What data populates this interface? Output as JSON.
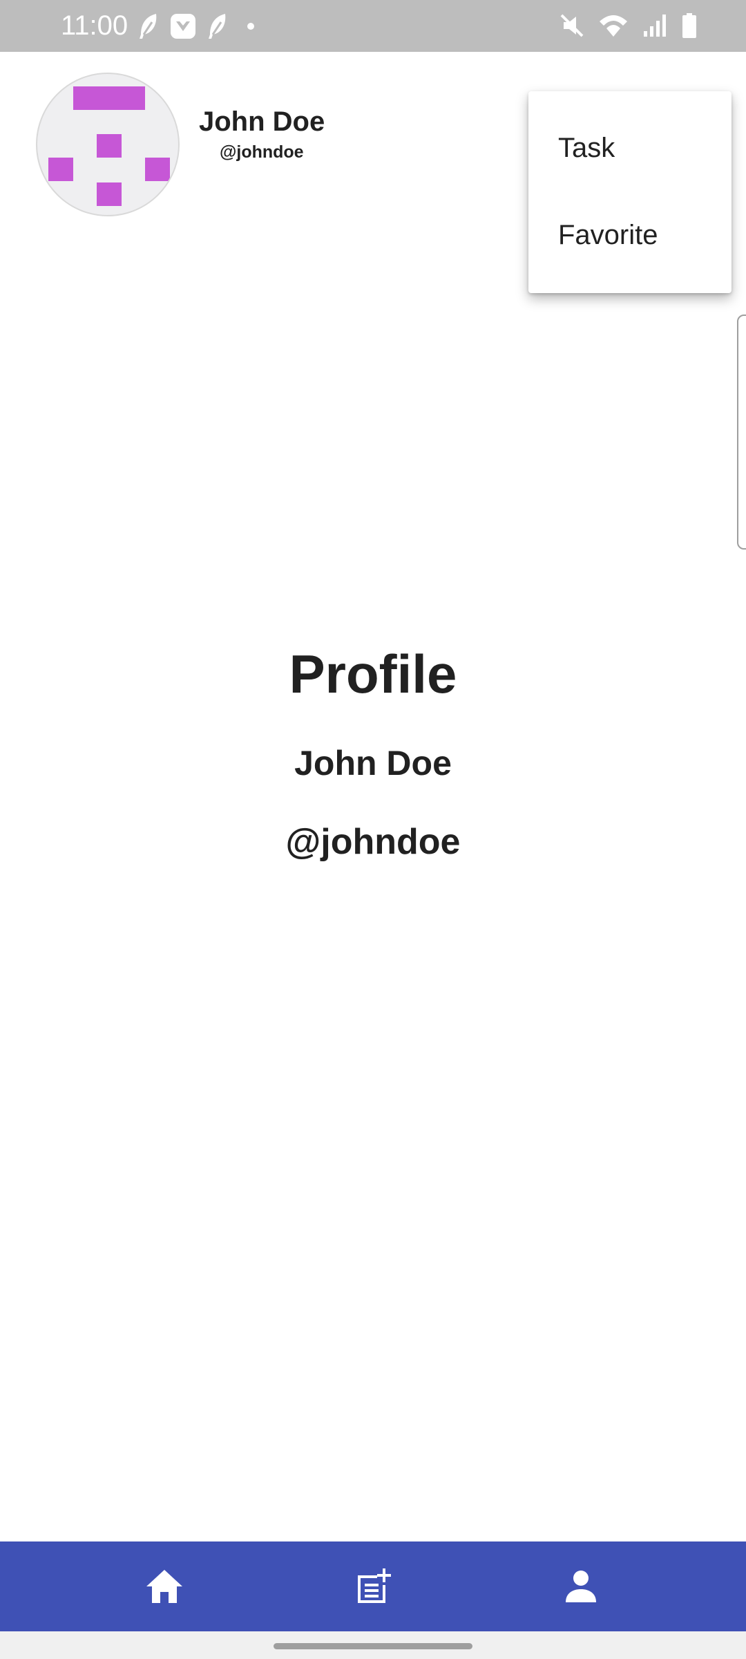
{
  "status_bar": {
    "time": "11:00",
    "left_icons": [
      "feather-icon",
      "shield-heart-icon",
      "feather-icon",
      "dot-icon"
    ],
    "right_icons": [
      "mute-icon",
      "wifi-icon",
      "signal-icon",
      "battery-icon"
    ],
    "background": "#bdbdbd"
  },
  "header": {
    "name": "John Doe",
    "handle": "@johndoe",
    "avatar_color": "#c657d6"
  },
  "menu": {
    "items": [
      {
        "label": "Task"
      },
      {
        "label": "Favorite"
      }
    ]
  },
  "profile": {
    "title": "Profile",
    "name": "John Doe",
    "handle": "@johndoe"
  },
  "bottom_nav": {
    "background": "#3f51b5",
    "items": [
      {
        "icon": "home-icon"
      },
      {
        "icon": "add-note-icon"
      },
      {
        "icon": "person-icon"
      }
    ]
  }
}
